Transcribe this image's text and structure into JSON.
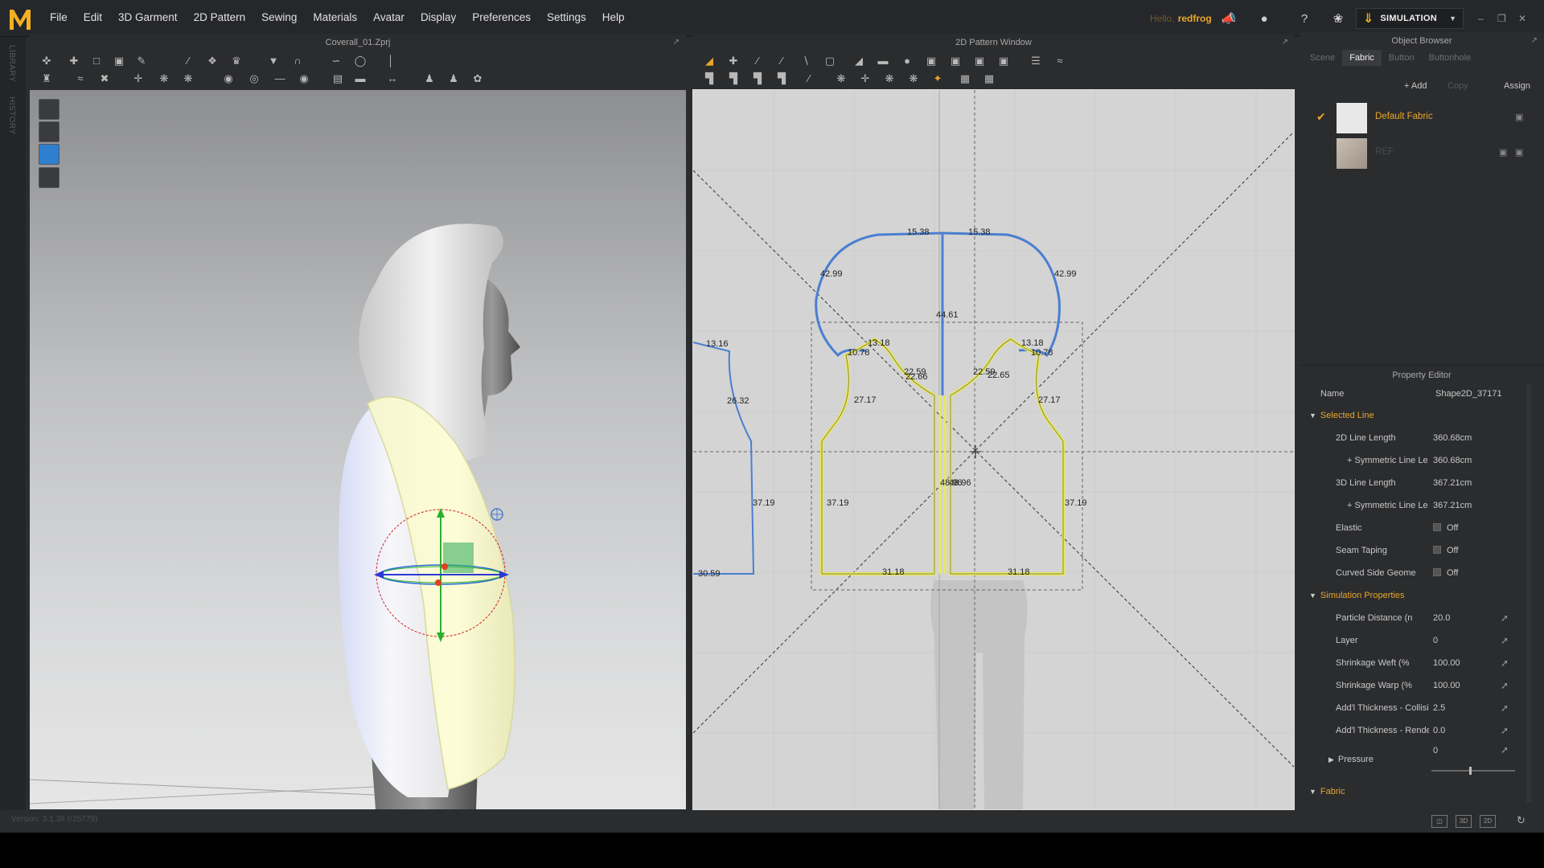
{
  "app": {
    "logo_letter": "M",
    "menu": [
      "File",
      "Edit",
      "3D Garment",
      "2D Pattern",
      "Sewing",
      "Materials",
      "Avatar",
      "Display",
      "Preferences",
      "Settings",
      "Help"
    ],
    "greeting": "Hello,",
    "username": "redfrog",
    "mode_label": "SIMULATION",
    "accent": "#e8a72a"
  },
  "side_tabs": [
    "LIBRARY",
    "HISTORY"
  ],
  "viewport3d": {
    "title": "Coverall_01.Zprj"
  },
  "pattern_window": {
    "title": "2D Pattern Window",
    "measurements": {
      "neck_l": "15.38",
      "neck_r": "15.38",
      "hood_l": "42.99",
      "hood_r": "42.99",
      "center": "44.61",
      "sleeve_l": "13.16",
      "sleeve_side": "26.32",
      "sleeve_lower": "37.19",
      "sleeve_bottom": "30.59",
      "shoulder_l": "13.18",
      "shoulder_r": "13.18",
      "armhole_l": "10.78",
      "armhole_r": "10.78",
      "neck_inner_l": "22.59",
      "neck_inner_l2": "22.66",
      "neck_inner_r": "22.59",
      "neck_inner_r2": "22.65",
      "armhole_depth_l": "27.17",
      "armhole_depth_r": "27.17",
      "front_center": "48.96",
      "front_center2": "48.96",
      "side_l": "37.19",
      "side_r": "37.19",
      "hem_l": "31.18",
      "hem_r": "31.18"
    }
  },
  "object_browser": {
    "title": "Object Browser",
    "tabs": [
      "Scene",
      "Fabric",
      "Button",
      "Buttonhole"
    ],
    "active_tab": "Fabric",
    "actions": {
      "add": "+ Add",
      "copy": "Copy",
      "assign": "Assign"
    },
    "items": [
      {
        "name": "Default Fabric",
        "selected": true
      },
      {
        "name": "REF",
        "selected": false
      }
    ]
  },
  "property_editor": {
    "title": "Property Editor",
    "name_label": "Name",
    "name_value": "Shape2D_37171",
    "selected_line": {
      "title": "Selected Line",
      "rows": [
        {
          "label": "2D Line Length",
          "value": "360.68cm",
          "sub": false
        },
        {
          "label": "+ Symmetric Line Le",
          "value": "360.68cm",
          "sub": true
        },
        {
          "label": "3D Line Length",
          "value": "367.21cm",
          "sub": false
        },
        {
          "label": "+ Symmetric Line Le",
          "value": "367.21cm",
          "sub": true
        }
      ],
      "toggles": [
        {
          "label": "Elastic",
          "value": "Off"
        },
        {
          "label": "Seam Taping",
          "value": "Off"
        },
        {
          "label": "Curved Side Geome",
          "value": "Off"
        }
      ]
    },
    "simulation": {
      "title": "Simulation Properties",
      "rows": [
        {
          "label": "Particle Distance (n",
          "value": "20.0"
        },
        {
          "label": "Layer",
          "value": "0"
        },
        {
          "label": "Shrinkage Weft (%",
          "value": "100.00"
        },
        {
          "label": "Shrinkage Warp (%",
          "value": "100.00"
        },
        {
          "label": "Add'l Thickness - Collisic",
          "value": "2.5"
        },
        {
          "label": "Add'l Thickness - Render",
          "value": "0.0"
        }
      ],
      "pressure_label": "Pressure",
      "pressure_value": "0",
      "pressure_fraction": 0.45
    },
    "fabric_section": "Fabric"
  },
  "status": {
    "version": "Version: 3.1.38 (r25779)"
  }
}
